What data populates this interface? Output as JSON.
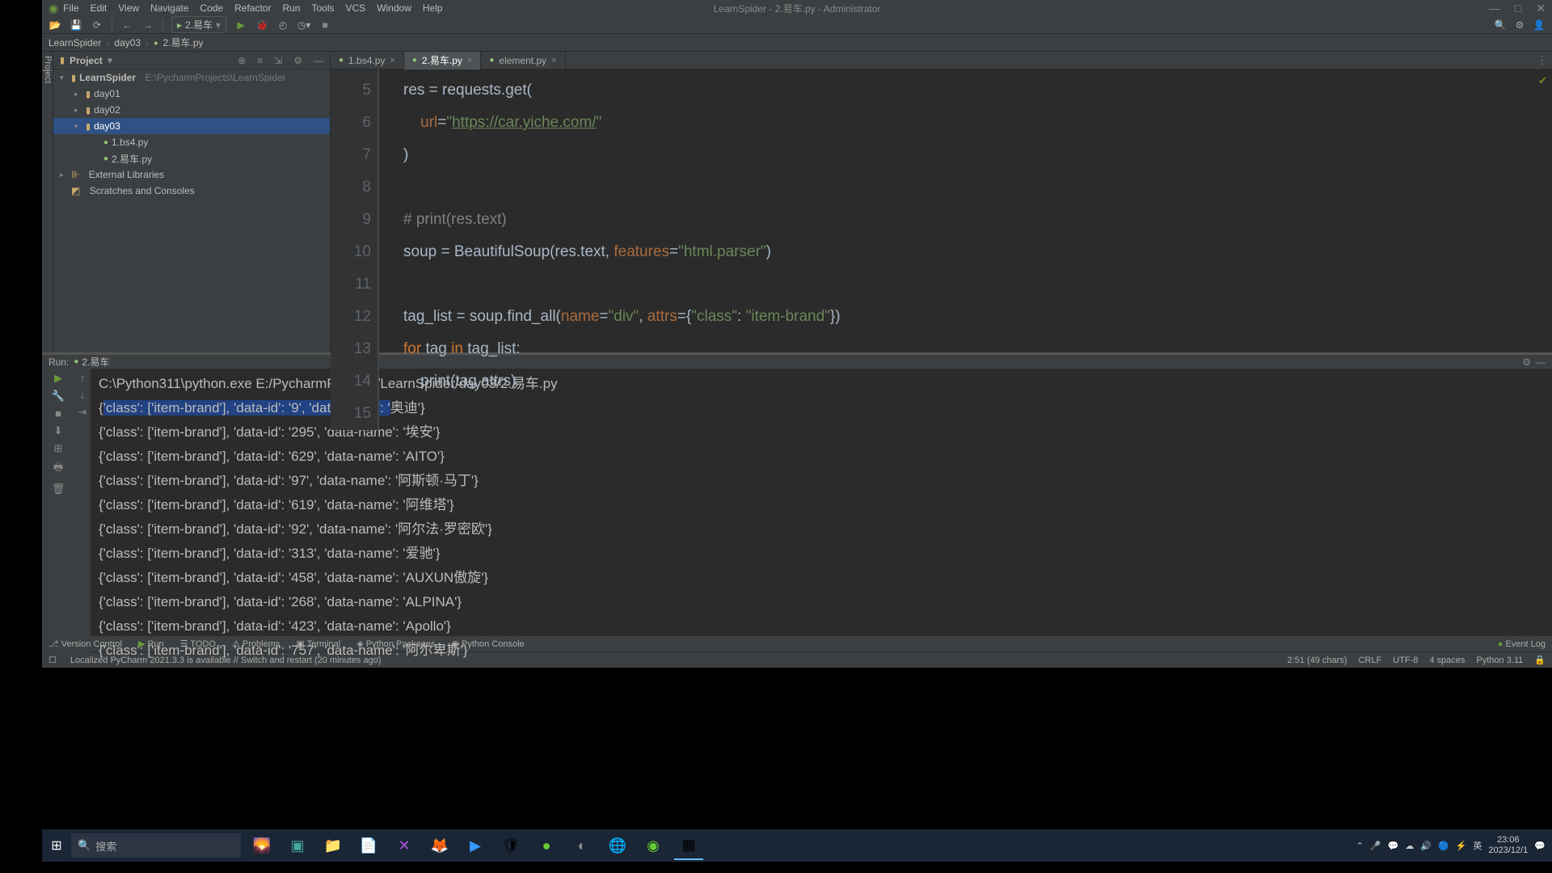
{
  "window_title": "LearnSpider - 2.易车.py - Administrator",
  "menu": [
    "File",
    "Edit",
    "View",
    "Navigate",
    "Code",
    "Refactor",
    "Run",
    "Tools",
    "VCS",
    "Window",
    "Help"
  ],
  "run_config": "2.易车",
  "breadcrumb": [
    "LearnSpider",
    "day03",
    "2.易车.py"
  ],
  "project": {
    "title": "Project",
    "root": "LearnSpider",
    "root_path": "E:\\PycharmProjects\\LearnSpider",
    "days": [
      "day01",
      "day02",
      "day03"
    ],
    "files": [
      "1.bs4.py",
      "2.易车.py"
    ],
    "ext_libs": "External Libraries",
    "scratches": "Scratches and Consoles"
  },
  "tabs": [
    {
      "name": "1.bs4.py",
      "active": false
    },
    {
      "name": "2.易车.py",
      "active": true
    },
    {
      "name": "element.py",
      "active": false
    }
  ],
  "line_numbers": [
    "5",
    "6",
    "7",
    "8",
    "9",
    "10",
    "11",
    "12",
    "13",
    "14",
    "15"
  ],
  "code": {
    "l5_a": "res = requests.get(",
    "l6_a": "url",
    "l6_b": "=",
    "l6_c": "\"",
    "l6_url": "https://car.yiche.com/",
    "l6_d": "\"",
    "l7": ")",
    "l9": "# print(res.text)",
    "l10_a": "soup = BeautifulSoup(res.text, ",
    "l10_b": "features",
    "l10_c": "=",
    "l10_d": "\"html.parser\"",
    "l10_e": ")",
    "l12_a": "tag_list = soup.find_all(",
    "l12_b": "name",
    "l12_c": "=",
    "l12_d": "\"div\"",
    "l12_e": ", ",
    "l12_f": "attrs",
    "l12_g": "={",
    "l12_h": "\"class\"",
    "l12_i": ": ",
    "l12_j": "\"item-brand\"",
    "l12_k": "})",
    "l13_a": "for ",
    "l13_b": "tag ",
    "l13_c": "in ",
    "l13_d": "tag_list:",
    "l14": "print(tag.attrs)"
  },
  "run": {
    "label": "Run:",
    "name": "2.易车",
    "cmd": "C:\\Python311\\python.exe E:/PycharmProjects/LearnSpider/day03/2.易车.py",
    "lines": [
      {
        "prefix": "{",
        "sel": "'class': ['item-brand'], 'data-id': '9', 'data-name': '",
        "suffix": "奥迪'}"
      },
      {
        "text": "{'class': ['item-brand'], 'data-id': '295', 'data-name': '埃安'}"
      },
      {
        "text": "{'class': ['item-brand'], 'data-id': '629', 'data-name': 'AITO'}"
      },
      {
        "text": "{'class': ['item-brand'], 'data-id': '97', 'data-name': '阿斯顿·马丁'}"
      },
      {
        "text": "{'class': ['item-brand'], 'data-id': '619', 'data-name': '阿维塔'}"
      },
      {
        "text": "{'class': ['item-brand'], 'data-id': '92', 'data-name': '阿尔法·罗密欧'}"
      },
      {
        "text": "{'class': ['item-brand'], 'data-id': '313', 'data-name': '爱驰'}"
      },
      {
        "text": "{'class': ['item-brand'], 'data-id': '458', 'data-name': 'AUXUN傲旋'}"
      },
      {
        "text": "{'class': ['item-brand'], 'data-id': '268', 'data-name': 'ALPINA'}"
      },
      {
        "text": "{'class': ['item-brand'], 'data-id': '423', 'data-name': 'Apollo'}"
      },
      {
        "text": "{'class': ['item-brand'], 'data-id': '757', 'data-name': '阿尔卑斯'}"
      }
    ]
  },
  "bottom_tabs": [
    "Version Control",
    "Run",
    "TODO",
    "Problems",
    "Terminal",
    "Python Packages",
    "Python Console"
  ],
  "event_log": "Event Log",
  "status_left": "Localized PyCharm 2021.3.3 is available // Switch and restart (20 minutes ago)",
  "status_right": [
    "2:51 (49 chars)",
    "CRLF",
    "UTF-8",
    "4 spaces",
    "Python 3.11"
  ],
  "taskbar": {
    "search_placeholder": "搜索",
    "time": "23:06",
    "date": "2023/12/1"
  }
}
